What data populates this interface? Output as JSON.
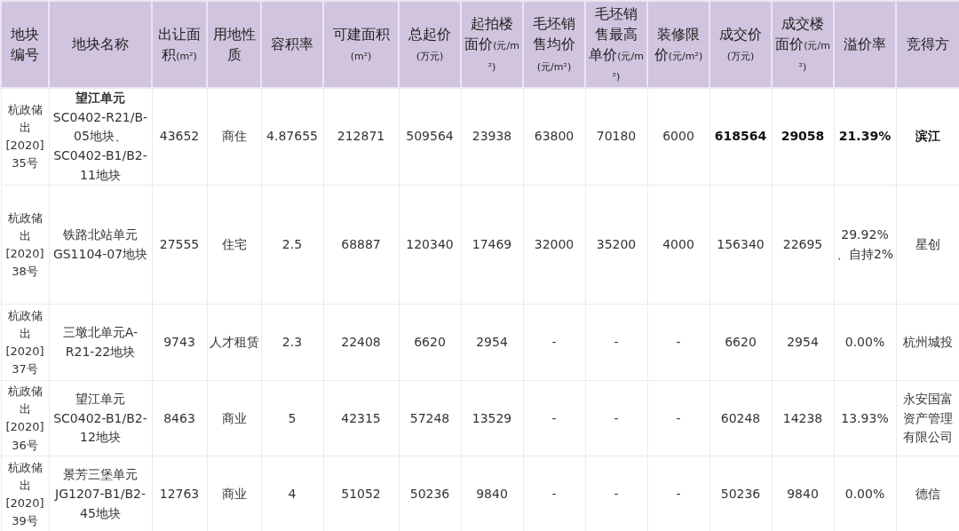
{
  "table": {
    "columns": [
      {
        "label": "地块编号"
      },
      {
        "label": "地块名称"
      },
      {
        "label": "出让面积",
        "unit": "(m²)"
      },
      {
        "label": "用地性质"
      },
      {
        "label": "容积率"
      },
      {
        "label": "可建面积",
        "unit": "(m²)"
      },
      {
        "label": "总起价",
        "unit": "(万元)"
      },
      {
        "label": "起拍楼面价",
        "unit": "(元/m²)"
      },
      {
        "label": "毛坯销售均价",
        "unit": "(元/m²)"
      },
      {
        "label": "毛坯销售最高单价",
        "unit": "(元/m²)"
      },
      {
        "label": "装修限价",
        "unit": "(元/m²)"
      },
      {
        "label": "成交价",
        "unit": "(万元)"
      },
      {
        "label": "成交楼面价",
        "unit": "(元/m²)"
      },
      {
        "label": "溢价率"
      },
      {
        "label": "竞得方"
      }
    ],
    "rows": [
      {
        "cells": [
          {
            "text": "杭政储出[2020]35号",
            "bold": false
          },
          {
            "text": "**望江单元**\nSC0402-R21/B-05地块、SC0402-B1/B2-11地块",
            "bold": false
          },
          {
            "text": "43652",
            "bold": false
          },
          {
            "text": "商住",
            "bold": false
          },
          {
            "text": "4.87655",
            "bold": false
          },
          {
            "text": "212871",
            "bold": false
          },
          {
            "text": "509564",
            "bold": false
          },
          {
            "text": "23938",
            "bold": false
          },
          {
            "text": "63800",
            "bold": false
          },
          {
            "text": "70180",
            "bold": false
          },
          {
            "text": "6000",
            "bold": false
          },
          {
            "text": "618564",
            "bold": true
          },
          {
            "text": "29058",
            "bold": true
          },
          {
            "text": "21.39%",
            "bold": true
          },
          {
            "text": "滨江",
            "bold": true
          }
        ]
      },
      {
        "cells": [
          {
            "text": "杭政储出[2020]38号",
            "bold": false
          },
          {
            "text": "铁路北站单元\nGS1104-07地块",
            "bold": false
          },
          {
            "text": "27555",
            "bold": false
          },
          {
            "text": "住宅",
            "bold": false
          },
          {
            "text": "2.5",
            "bold": false
          },
          {
            "text": "68887",
            "bold": false
          },
          {
            "text": "120340",
            "bold": false
          },
          {
            "text": "17469",
            "bold": false
          },
          {
            "text": "32000",
            "bold": false
          },
          {
            "text": "35200",
            "bold": false
          },
          {
            "text": "4000",
            "bold": false
          },
          {
            "text": "156340",
            "bold": false
          },
          {
            "text": "22695",
            "bold": false
          },
          {
            "text": "29.92%、自持2%",
            "bold": false
          },
          {
            "text": "星创",
            "bold": false
          }
        ]
      },
      {
        "cells": [
          {
            "text": "杭政储出[2020]37号",
            "bold": false
          },
          {
            "text": "三墩北单元A-R21-22地块",
            "bold": false
          },
          {
            "text": "9743",
            "bold": false
          },
          {
            "text": "人才租赁",
            "bold": false
          },
          {
            "text": "2.3",
            "bold": false
          },
          {
            "text": "22408",
            "bold": false
          },
          {
            "text": "6620",
            "bold": false
          },
          {
            "text": "2954",
            "bold": false
          },
          {
            "text": "-",
            "bold": false
          },
          {
            "text": "-",
            "bold": false
          },
          {
            "text": "-",
            "bold": false
          },
          {
            "text": "6620",
            "bold": false
          },
          {
            "text": "2954",
            "bold": false
          },
          {
            "text": "0.00%",
            "bold": false
          },
          {
            "text": "杭州城投",
            "bold": false
          }
        ]
      },
      {
        "cells": [
          {
            "text": "杭政储出[2020]36号",
            "bold": false
          },
          {
            "text": "望江单元\nSC0402-B1/B2-12地块",
            "bold": false
          },
          {
            "text": "8463",
            "bold": false
          },
          {
            "text": "商业",
            "bold": false
          },
          {
            "text": "5",
            "bold": false
          },
          {
            "text": "42315",
            "bold": false
          },
          {
            "text": "57248",
            "bold": false
          },
          {
            "text": "13529",
            "bold": false
          },
          {
            "text": "-",
            "bold": false
          },
          {
            "text": "-",
            "bold": false
          },
          {
            "text": "-",
            "bold": false
          },
          {
            "text": "60248",
            "bold": false
          },
          {
            "text": "14238",
            "bold": false
          },
          {
            "text": "13.93%",
            "bold": false
          },
          {
            "text": "永安国富资产管理有限公司",
            "bold": false
          }
        ]
      },
      {
        "cells": [
          {
            "text": "杭政储出[2020]39号",
            "bold": false
          },
          {
            "text": "景芳三堡单元\nJG1207-B1/B2-45地块",
            "bold": false
          },
          {
            "text": "12763",
            "bold": false
          },
          {
            "text": "商业",
            "bold": false
          },
          {
            "text": "4",
            "bold": false
          },
          {
            "text": "51052",
            "bold": false
          },
          {
            "text": "50236",
            "bold": false
          },
          {
            "text": "9840",
            "bold": false
          },
          {
            "text": "-",
            "bold": false
          },
          {
            "text": "-",
            "bold": false
          },
          {
            "text": "-",
            "bold": false
          },
          {
            "text": "50236",
            "bold": false
          },
          {
            "text": "9840",
            "bold": false
          },
          {
            "text": "0.00%",
            "bold": false
          },
          {
            "text": "德信",
            "bold": false
          }
        ]
      }
    ]
  }
}
